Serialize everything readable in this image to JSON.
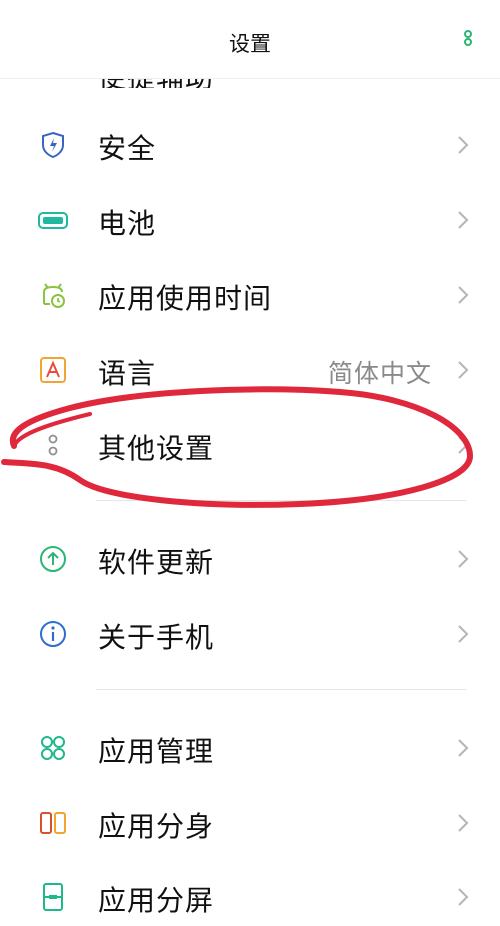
{
  "header": {
    "title": "设置"
  },
  "peek": {
    "label": "便捷辅助"
  },
  "items": [
    {
      "label": "安全",
      "icon": "shield-icon"
    },
    {
      "label": "电池",
      "icon": "battery-icon"
    },
    {
      "label": "应用使用时间",
      "icon": "app-usage-timer-icon"
    },
    {
      "label": "语言",
      "value": "简体中文",
      "icon": "language-icon"
    },
    {
      "label": "其他设置",
      "icon": "other-settings-icon"
    },
    {
      "label": "软件更新",
      "icon": "software-update-icon"
    },
    {
      "label": "关于手机",
      "icon": "about-phone-icon"
    },
    {
      "label": "应用管理",
      "icon": "app-management-icon"
    },
    {
      "label": "应用分身",
      "icon": "app-clone-icon"
    },
    {
      "label": "应用分屏",
      "icon": "split-screen-icon"
    }
  ],
  "colors": {
    "accent_green": "#2bb673",
    "annotation_red": "#e0283c",
    "shield_blue": "#3a63c8",
    "battery_teal": "#1fb8a0",
    "usage_green": "#8ac43f",
    "language_orange": "#f3a32f",
    "about_blue": "#2c6fd1"
  }
}
